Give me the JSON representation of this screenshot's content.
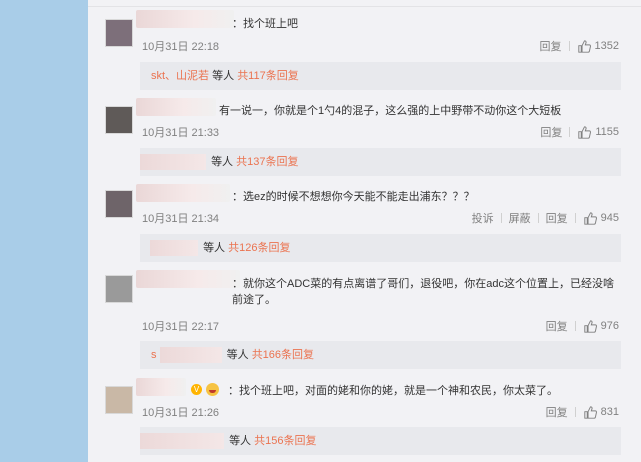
{
  "comments": [
    {
      "text": "：找个班上吧",
      "time": "10月31日 22:18",
      "actions": [
        "回复"
      ],
      "likes": "1352",
      "reply_prefix": "skt、山泥若",
      "reply_mid": "等人",
      "reply_count": "共117条回复"
    },
    {
      "text": "有一说一，你就是个1勺4的混子，这么强的上中野带不动你这个大短板",
      "time": "10月31日 21:33",
      "actions": [
        "回复"
      ],
      "likes": "1155",
      "reply_prefix": "",
      "reply_mid": "等人",
      "reply_count": "共137条回复"
    },
    {
      "text": "：选ez的时候不想想你今天能不能走出浦东？？？",
      "time": "10月31日 21:34",
      "actions": [
        "投诉",
        "屏蔽",
        "回复"
      ],
      "likes": "945",
      "reply_prefix": "",
      "reply_mid": "等人",
      "reply_count": "共126条回复"
    },
    {
      "text": "：就你这个ADC菜的有点离谱了哥们，退役吧，你在adc这个位置上，已经没啥前途了。",
      "time": "10月31日 22:17",
      "actions": [
        "回复"
      ],
      "likes": "976",
      "reply_prefix": "s",
      "reply_mid": "等人",
      "reply_count": "共166条回复"
    },
    {
      "text": "：找个班上吧，对面的姥和你的姥，就是一个神和农民，你太菜了。",
      "time": "10月31日 21:26",
      "actions": [
        "回复"
      ],
      "likes": "831",
      "reply_prefix": "",
      "reply_mid": "等人",
      "reply_count": "共156条回复"
    }
  ],
  "icons": {
    "like": "thumbs-up-icon",
    "verified": "v-badge-icon"
  },
  "colors": {
    "accent": "#eb7350",
    "meta": "#808080",
    "reply_bg": "#e8e9ed",
    "side_bg": "#a9cde8"
  }
}
